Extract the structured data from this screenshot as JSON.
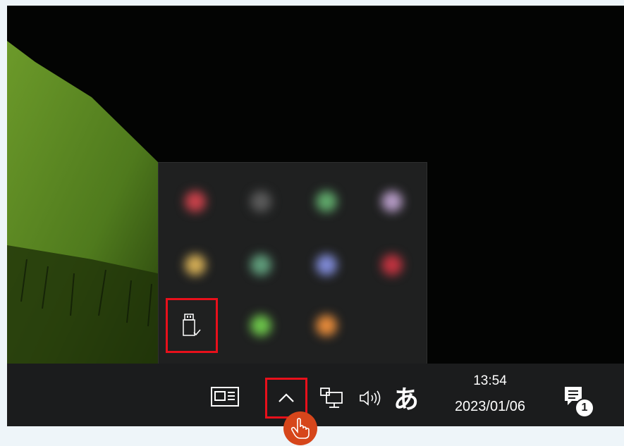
{
  "taskbar": {
    "clock": {
      "time": "13:54",
      "date": "2023/01/06"
    },
    "ime_indicator": "あ",
    "notification_count": "1",
    "icons": [
      "news-and-interests-icon",
      "chevron-up-icon",
      "network-icon",
      "volume-icon",
      "ime-icon",
      "action-center-icon"
    ]
  },
  "tray_flyout": {
    "icons": [
      {
        "name": "app-icon-red",
        "color": "#c8414a"
      },
      {
        "name": "app-icon-gray",
        "color": "#5a5a5a"
      },
      {
        "name": "app-icon-green",
        "color": "#5fa86a"
      },
      {
        "name": "app-icon-multi",
        "color": "#b49ac4"
      },
      {
        "name": "app-icon-yellow",
        "color": "#d2ac55"
      },
      {
        "name": "app-icon-teal",
        "color": "#5f9c7a"
      },
      {
        "name": "app-icon-blue",
        "color": "#7f8ad6"
      },
      {
        "name": "app-icon-crimson",
        "color": "#c0333f"
      },
      {
        "name": "usb-safely-remove-icon",
        "color": "#ffffff"
      },
      {
        "name": "app-icon-lime",
        "color": "#6cc44a"
      },
      {
        "name": "app-icon-orange",
        "color": "#e58a3a"
      }
    ]
  },
  "colors": {
    "highlight": "#e8101b",
    "cursor": "#d6461b",
    "taskbar": "#1b1c1d"
  }
}
